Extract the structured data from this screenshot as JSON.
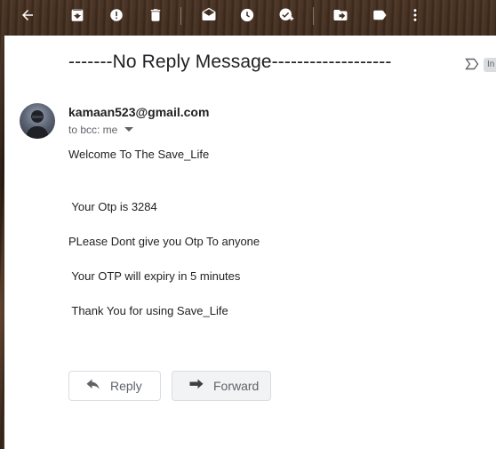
{
  "toolbar": {
    "items": [
      {
        "icon": "arrow-left-icon"
      },
      {
        "icon": "archive-icon"
      },
      {
        "icon": "report-spam-icon"
      },
      {
        "icon": "delete-icon"
      },
      {
        "icon": "mark-unread-icon"
      },
      {
        "icon": "snooze-icon"
      },
      {
        "icon": "add-task-icon"
      },
      {
        "icon": "move-to-icon"
      },
      {
        "icon": "label-icon"
      },
      {
        "icon": "more-vert-icon"
      }
    ]
  },
  "email": {
    "subject": "-------No Reply Message-------------------",
    "label": "In",
    "sender": "kamaan523@gmail.com",
    "recipients": "to bcc: me",
    "body": {
      "greeting": "Welcome To The Save_Life",
      "otp": " Your Otp is 3284",
      "warning": "PLease Dont give you Otp To anyone",
      "expiry": " Your OTP will expiry in 5 minutes",
      "thanks": " Thank You for using Save_Life"
    }
  },
  "actions": {
    "reply_label": "Reply",
    "forward_label": "Forward"
  },
  "colors": {
    "card_bg": "#ffffff",
    "text_primary": "#202124",
    "text_secondary": "#5f6368",
    "button_border": "#dadce0"
  }
}
